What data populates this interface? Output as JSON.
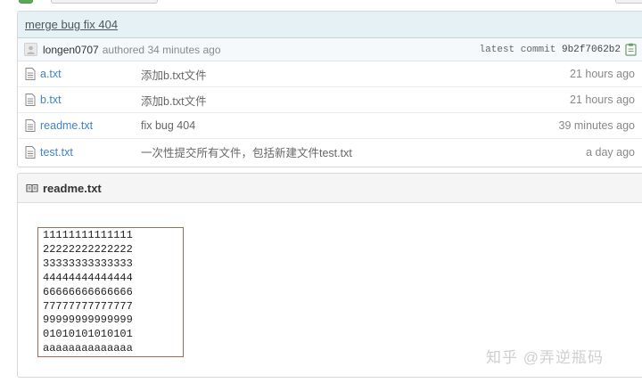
{
  "commit": {
    "message": "merge bug fix 404",
    "author": "longen0707",
    "authored_text": "authored 34 minutes ago",
    "latest_label": "latest commit",
    "sha": "9b2f7062b2"
  },
  "files": [
    {
      "name": "a.txt",
      "message": "添加b.txt文件",
      "age": "21 hours ago"
    },
    {
      "name": "b.txt",
      "message": "添加b.txt文件",
      "age": "21 hours ago"
    },
    {
      "name": "readme.txt",
      "message": "fix bug 404",
      "age": "39 minutes ago"
    },
    {
      "name": "test.txt",
      "message": "一次性提交所有文件，包括新建文件test.txt",
      "age": "a day ago"
    }
  ],
  "readme": {
    "title": "readme.txt",
    "lines": [
      "11111111111111",
      "22222222222222",
      "33333333333333",
      "44444444444444",
      "66666666666666",
      "77777777777777",
      "99999999999999",
      "01010101010101",
      "aaaaaaaaaaaaaa"
    ]
  },
  "watermark": "知乎 @弄逆瓶码",
  "icons": {
    "file": "file-text-icon",
    "book": "book-icon",
    "clipboard": "clipboard-icon",
    "avatar": "avatar-icon"
  }
}
